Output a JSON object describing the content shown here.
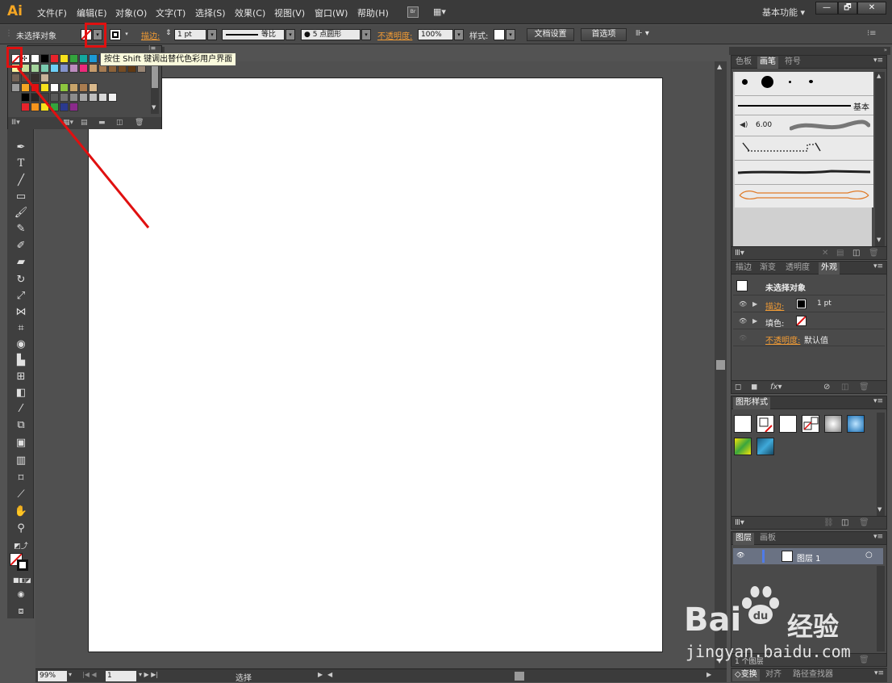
{
  "app": {
    "logo": "Ai"
  },
  "menu": [
    "文件(F)",
    "编辑(E)",
    "对象(O)",
    "文字(T)",
    "选择(S)",
    "效果(C)",
    "视图(V)",
    "窗口(W)",
    "帮助(H)"
  ],
  "bridge_label": "Br",
  "workspace": "基本功能",
  "window_buttons": {
    "minimize": "—",
    "restore": "🗗",
    "close": "✕"
  },
  "control_bar": {
    "selection": "未选择对象",
    "stroke_label": "描边:",
    "stroke_weight": "1 pt",
    "profile": "等比",
    "brush": "5 点圆形",
    "opacity_label": "不透明度:",
    "opacity": "100%",
    "style_label": "样式:",
    "doc_setup": "文档设置",
    "preferences": "首选项"
  },
  "tooltip": "按住 Shift 键调出替代色彩用户界面",
  "swatch_colors": [
    "#ffffff",
    "#000000",
    "#e8232b",
    "#f7e11b",
    "#33a43d",
    "#13a89e",
    "#1c9ad6",
    "#2b3a8e",
    "#8a2a8b",
    "#d7d7d7",
    "#f6b3b3",
    "#f8d7a6",
    "#fbf49f",
    "#c4df9b",
    "#a3d39c",
    "#7acbb0",
    "#6dcff6",
    "#8493ca",
    "#bd8cbf",
    "#ee2a7b",
    "#c69c6d",
    "#a67c52",
    "#8c6239",
    "#754c24",
    "#603913",
    "#998675",
    "#736357",
    "#534741",
    "#362f2d",
    "#c7b299"
  ],
  "gray_swatches": [
    "#000000",
    "#262626",
    "#404040",
    "#595959",
    "#737373",
    "#8c8c8c",
    "#a6a6a6",
    "#bfbfbf",
    "#d9d9d9",
    "#f2f2f2"
  ],
  "brush_panel": {
    "tabs": [
      "色板",
      "画笔",
      "符号"
    ],
    "basic_label": "基本",
    "brush_size": "6.00"
  },
  "appearance_panel": {
    "tabs": [
      "描边",
      "渐变",
      "透明度",
      "外观"
    ],
    "title": "未选择对象",
    "stroke_label": "描边:",
    "stroke_value": "1 pt",
    "fill_label": "填色:",
    "opacity_label": "不透明度:",
    "opacity_value": "默认值"
  },
  "graphic_styles_panel": {
    "tabs": [
      "图形样式"
    ]
  },
  "layers_panel": {
    "tabs": [
      "图层",
      "画板"
    ],
    "layer_name": "图层 1",
    "layer_count": "1 个图层"
  },
  "bottom_tabs": [
    "变换",
    "对齐",
    "路径查找器"
  ],
  "status": {
    "zoom": "99%",
    "page": "1",
    "mode": "选择"
  },
  "watermark": {
    "brand": "Bai",
    "brand2": "经验",
    "url": "jingyan.baidu.com"
  },
  "colors": {
    "accent": "#f39c34",
    "highlight": "#e01010",
    "logo": "#f5a623"
  }
}
